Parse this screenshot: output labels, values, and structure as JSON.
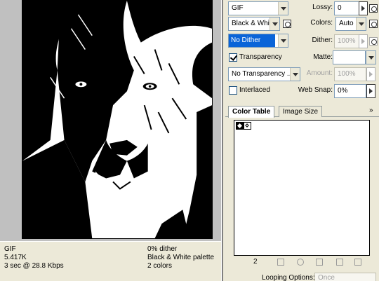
{
  "preview": {
    "image_alt": "lion-face"
  },
  "info": {
    "format": "GIF",
    "size": "5.417K",
    "speed": "3 sec @ 28.8 Kbps",
    "dither": "0% dither",
    "palette": "Black & White palette",
    "colors": "2 colors"
  },
  "settings": {
    "format": "GIF",
    "reduction": "Black & White",
    "dither_algorithm": "No Dither",
    "transparency_label": "Transparency",
    "transparency_checked": true,
    "transparency_dither": "No Transparency ...",
    "interlaced_label": "Interlaced",
    "interlaced_checked": false,
    "lossy_label": "Lossy:",
    "lossy_value": "0",
    "colors_label": "Colors:",
    "colors_value": "Auto",
    "dither_label": "Dither:",
    "dither_value": "100%",
    "matte_label": "Matte:",
    "amount_label": "Amount:",
    "amount_value": "100%",
    "websnap_label": "Web Snap:",
    "websnap_value": "0%"
  },
  "tabs": [
    {
      "label": "Color Table",
      "active": true
    },
    {
      "label": "Image Size",
      "active": false
    }
  ],
  "panel_menu_glyph": "»",
  "color_table": {
    "count": "2",
    "swatches": [
      "#000000",
      "#ffffff"
    ]
  },
  "looping": {
    "label": "Looping Options:",
    "value": "Once"
  }
}
